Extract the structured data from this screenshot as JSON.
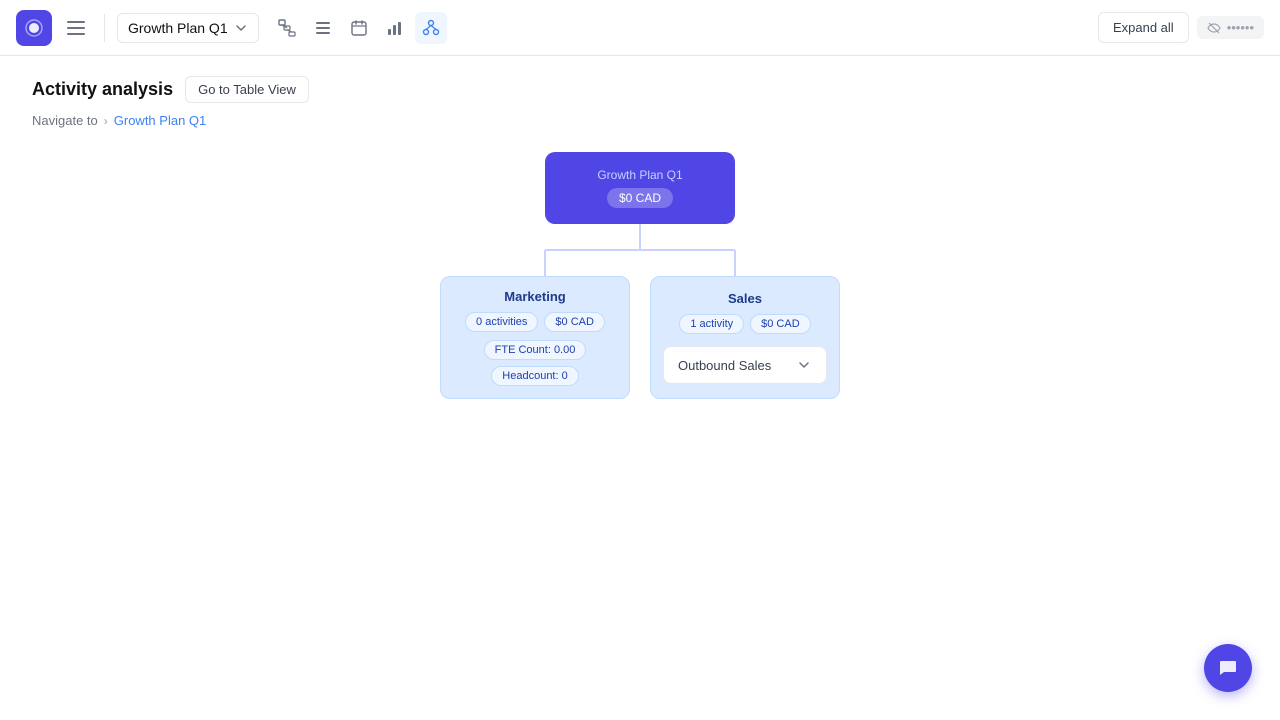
{
  "topbar": {
    "plan_label": "Growth Plan Q1",
    "expand_all": "Expand all",
    "user_label": "••••••"
  },
  "toolbar": {
    "icons": [
      "hierarchy-icon",
      "list-icon",
      "calendar-icon",
      "chart-icon",
      "grid-icon"
    ]
  },
  "page": {
    "title": "Activity analysis",
    "table_view_label": "Go to Table View",
    "breadcrumb_navigate": "Navigate to",
    "breadcrumb_plan": "Growth Plan Q1"
  },
  "root_node": {
    "label": "Growth Plan Q1",
    "budget": "$0 CAD"
  },
  "marketing_node": {
    "label": "Marketing",
    "activities": "0 activities",
    "budget": "$0 CAD",
    "fte": "FTE Count: 0.00",
    "headcount": "Headcount: 0"
  },
  "sales_node": {
    "label": "Sales",
    "activities": "1 activity",
    "budget": "$0 CAD"
  },
  "outbound_node": {
    "label": "Outbound Sales"
  }
}
